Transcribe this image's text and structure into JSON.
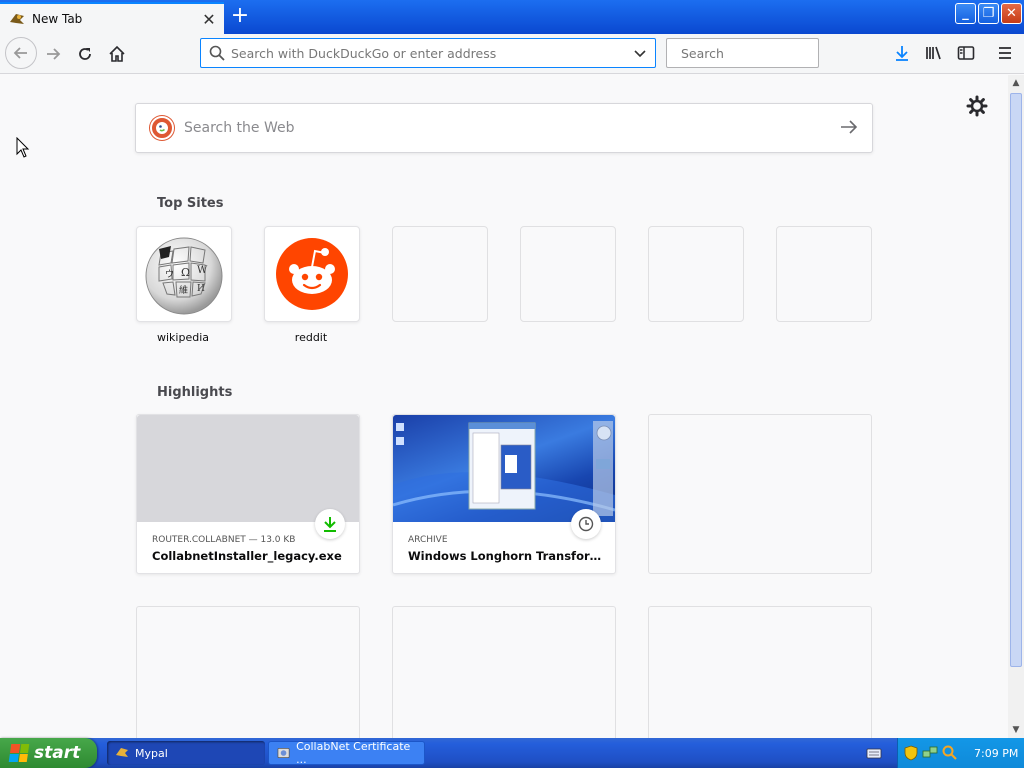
{
  "tab": {
    "title": "New Tab",
    "close": "✕"
  },
  "newtab_symbol": "+",
  "window_controls": {
    "minimize": "_",
    "restore": "❐",
    "close": "✕"
  },
  "urlbar": {
    "placeholder": "Search with DuckDuckGo or enter address"
  },
  "searchbar": {
    "placeholder": "Search"
  },
  "web_search": {
    "placeholder": "Search the Web"
  },
  "top_sites": {
    "title": "Top Sites",
    "sites": [
      {
        "label": "wikipedia"
      },
      {
        "label": "reddit"
      },
      {
        "label": ""
      },
      {
        "label": ""
      },
      {
        "label": ""
      },
      {
        "label": ""
      }
    ]
  },
  "highlights": {
    "title": "Highlights",
    "cards": [
      {
        "meta": "ROUTER.COLLABNET — 13.0 KB",
        "name": "CollabnetInstaller_legacy.exe",
        "badge": "download-icon"
      },
      {
        "meta": "ARCHIVE",
        "name": "Windows Longhorn Transformat...",
        "badge": "clock-icon"
      }
    ]
  },
  "taskbar": {
    "start_label": "start",
    "tasks": [
      {
        "label": "Mypal",
        "active": true
      },
      {
        "label": "CollabNet Certificate ...",
        "active": false
      }
    ],
    "clock": "7:09 PM"
  },
  "colors": {
    "accent": "#0a84ff",
    "reddit": "#ff4500",
    "download_green": "#12bc00",
    "xp_blue": "#245edb",
    "start_green": "#3a9a3d"
  }
}
